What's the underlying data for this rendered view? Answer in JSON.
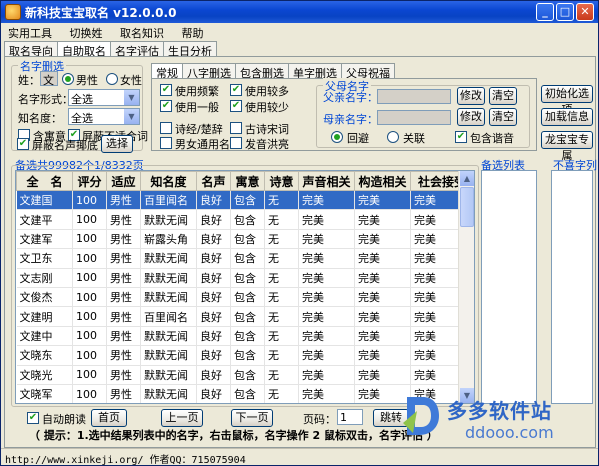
{
  "window": {
    "title": "新科技宝宝取名 v12.0.0.0",
    "min": "_",
    "max": "□",
    "close": "✕"
  },
  "menu": [
    "实用工具",
    "切换姓",
    "取名知识",
    "帮助"
  ],
  "main_tabs": [
    "取名导向",
    "自助取名",
    "名字评估",
    "生日分析"
  ],
  "name_filter": {
    "title": "名字删选",
    "surname_label": "姓：",
    "surname_value": "文",
    "male": "男性",
    "female": "女性",
    "form_label": "名字形式：",
    "form_value": "全选",
    "fame_label": "知名度：",
    "fame_value": "全选",
    "cb_meaning": "含寓意",
    "cb_block_bad": "屏蔽不适合词",
    "cb_block_famous": "屏蔽名声揶底",
    "select_btn": "选择"
  },
  "sub_tabs": [
    "常规",
    "八字删选",
    "包含删选",
    "单字删选",
    "父母祝福"
  ],
  "options": {
    "freq": "使用频繁",
    "normal": "使用一般",
    "more": "使用较多",
    "less": "使用较少",
    "poem": "诗经/楚辞",
    "ancient": "古诗宋词",
    "unisex": "男女通用名",
    "loud": "发音洪亮"
  },
  "parents": {
    "title": "父母名字",
    "father_label": "父亲名字：",
    "mother_label": "母亲名字：",
    "edit": "修改",
    "clear": "清空",
    "avoid": "回避",
    "related": "关联",
    "homophone": "包含谐音"
  },
  "right_buttons": [
    "初始化选项",
    "加载信息",
    "龙宝宝专属"
  ],
  "candidates_label": "备选共99982个1/8332页",
  "backup_list_label": "备选列表",
  "dislike_list_label": "不喜字列",
  "table": {
    "headers": [
      "全　名",
      "评分",
      "适应",
      "知名度",
      "名声",
      "寓意",
      "诗意",
      "声音相关",
      "构造相关",
      "社会接受"
    ],
    "rows": [
      [
        "文建国",
        "100",
        "男性",
        "百里闻名",
        "良好",
        "包含",
        "无",
        "完美",
        "完美",
        "完美"
      ],
      [
        "文建平",
        "100",
        "男性",
        "默默无闻",
        "良好",
        "包含",
        "无",
        "完美",
        "完美",
        "完美"
      ],
      [
        "文建军",
        "100",
        "男性",
        "崭露头角",
        "良好",
        "包含",
        "无",
        "完美",
        "完美",
        "完美"
      ],
      [
        "文卫东",
        "100",
        "男性",
        "默默无闻",
        "良好",
        "包含",
        "无",
        "完美",
        "完美",
        "完美"
      ],
      [
        "文志刚",
        "100",
        "男性",
        "默默无闻",
        "良好",
        "包含",
        "无",
        "完美",
        "完美",
        "完美"
      ],
      [
        "文俊杰",
        "100",
        "男性",
        "默默无闻",
        "良好",
        "包含",
        "无",
        "完美",
        "完美",
        "完美"
      ],
      [
        "文建明",
        "100",
        "男性",
        "百里闻名",
        "良好",
        "包含",
        "无",
        "完美",
        "完美",
        "完美"
      ],
      [
        "文建中",
        "100",
        "男性",
        "默默无闻",
        "良好",
        "包含",
        "无",
        "完美",
        "完美",
        "完美"
      ],
      [
        "文晓东",
        "100",
        "男性",
        "默默无闻",
        "良好",
        "包含",
        "无",
        "完美",
        "完美",
        "完美"
      ],
      [
        "文晓光",
        "100",
        "男性",
        "默默无闻",
        "良好",
        "包含",
        "无",
        "完美",
        "完美",
        "完美"
      ],
      [
        "文晓军",
        "100",
        "男性",
        "默默无闻",
        "良好",
        "包含",
        "无",
        "完美",
        "完美",
        "完美"
      ],
      [
        "文永刚",
        "100",
        "男性",
        "默默无闻",
        "良好",
        "包含",
        "无",
        "完美",
        "完美",
        "完美"
      ]
    ]
  },
  "bottom": {
    "auto_read": "自动朗读",
    "first": "首页",
    "prev": "上一页",
    "next": "下一页",
    "page_label": "页码：",
    "page_value": "1",
    "jump": "跳转",
    "hint": "（ 提示：1.选中结果列表中的名字，右击鼠标，名字操作 2 鼠标双击，名字评估 ）"
  },
  "statusbar": "http://www.xinkeji.org/ 作者QQ：715075904",
  "watermark": {
    "text": "多多软件站",
    "url": "ddooo.com"
  },
  "colors": {
    "titlebar": "#0b47d2",
    "selection": "#316ac5",
    "accent": "#0046d5",
    "check": "#21a121"
  }
}
